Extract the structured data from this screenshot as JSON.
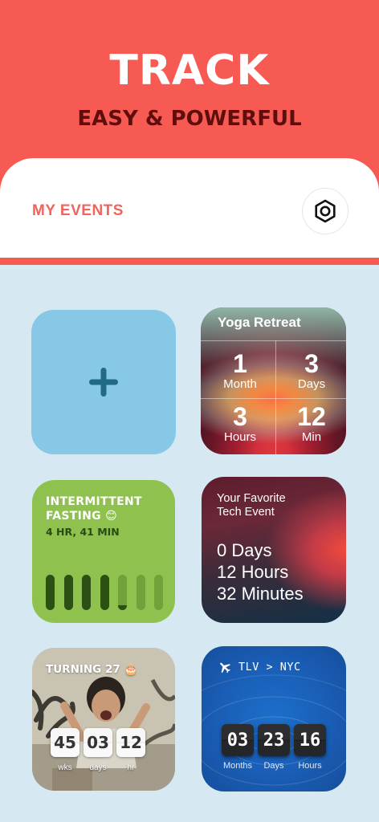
{
  "hero": {
    "title": "TRACK",
    "subtitle": "EASY & POWERFUL",
    "bg_color": "#f65a52"
  },
  "header": {
    "title": "MY EVENTS",
    "settings_icon": "gear-icon"
  },
  "add_card": {
    "icon": "plus-icon",
    "bg_color": "#86c8e6"
  },
  "yoga": {
    "title": "Yoga Retreat",
    "cells": [
      {
        "value": "1",
        "unit": "Month"
      },
      {
        "value": "3",
        "unit": "Days"
      },
      {
        "value": "3",
        "unit": "Hours"
      },
      {
        "value": "12",
        "unit": "Min"
      }
    ]
  },
  "fasting": {
    "title_line1": "INTERMITTENT",
    "title_line2": "FASTING 😊",
    "elapsed": "4 HR, 41 MIN",
    "progress": 0.59,
    "bar_count": 7,
    "bar_color": "#2c5014"
  },
  "tech": {
    "title_line1": "Your Favorite",
    "title_line2": "Tech Event",
    "days": "0 Days",
    "hours": "12 Hours",
    "minutes": "32 Minutes"
  },
  "birthday": {
    "title": "TURNING 27 🎂",
    "flips": [
      {
        "value": "45",
        "label": "wks"
      },
      {
        "value": "03",
        "label": "days"
      },
      {
        "value": "12",
        "label": "hr"
      }
    ]
  },
  "flight": {
    "icon": "airplane-icon",
    "route": "TLV > NYC",
    "flips": [
      {
        "value": "03",
        "label": "Months"
      },
      {
        "value": "23",
        "label": "Days"
      },
      {
        "value": "16",
        "label": "Hours"
      }
    ]
  }
}
